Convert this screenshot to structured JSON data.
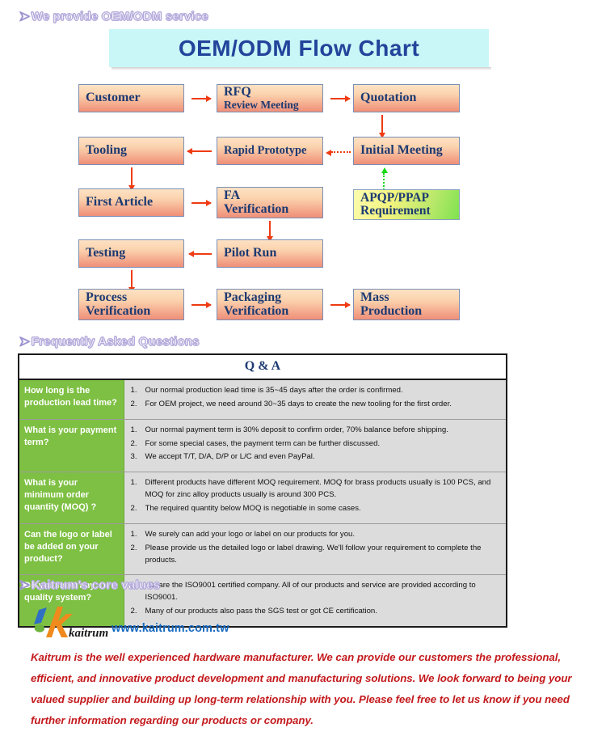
{
  "sections": {
    "oem": "We provide OEM/ODM service",
    "faq": "Frequently Asked Questions",
    "core": "Kaitrum's core values"
  },
  "flowchart": {
    "banner_title": "OEM/ODM Flow Chart",
    "banner_bg": "#c9f6f6",
    "box_border": "#7b8fb5",
    "box_text_color": "#1d3a72",
    "arrow_color": "#ef3b12",
    "green_arrow_color": "#16d916",
    "boxes": [
      {
        "id": "customer",
        "line1": "Customer",
        "line2": ""
      },
      {
        "id": "rfq",
        "line1": "RFQ",
        "line2": "Review Meeting"
      },
      {
        "id": "quotation",
        "line1": "Quotation",
        "line2": ""
      },
      {
        "id": "tooling",
        "line1": "Tooling",
        "line2": ""
      },
      {
        "id": "rapid-prototype",
        "line1": "Rapid Prototype",
        "line2": ""
      },
      {
        "id": "initial-meeting",
        "line1": "Initial Meeting",
        "line2": ""
      },
      {
        "id": "first-article",
        "line1": "First Article",
        "line2": ""
      },
      {
        "id": "fa-verification",
        "line1": "FA",
        "line2": "Verification"
      },
      {
        "id": "apqp-ppap",
        "line1": "APQP/PPAP",
        "line2": "Requirement"
      },
      {
        "id": "testing",
        "line1": "Testing",
        "line2": ""
      },
      {
        "id": "pilot-run",
        "line1": "Pilot Run",
        "line2": ""
      },
      {
        "id": "process-verification",
        "line1": "Process",
        "line2": "Verification"
      },
      {
        "id": "packaging-verification",
        "line1": "Packaging",
        "line2": "Verification"
      },
      {
        "id": "mass-production",
        "line1": "Mass",
        "line2": "Production"
      }
    ]
  },
  "qa": {
    "title": "Q & A",
    "question_bg": "#7ec043",
    "answer_bg": "#dcdcdc",
    "rows": [
      {
        "question": "How long is the production lead time?",
        "answers": [
          "Our normal production lead time is 35~45 days after the order is confirmed.",
          "For OEM project, we need around 30~35 days to create the new tooling for the first order."
        ]
      },
      {
        "question": "What is your payment term?",
        "answers": [
          "Our normal payment term is 30% deposit to confirm order, 70% balance before shipping.",
          "For some special cases, the payment term can be further discussed.",
          "We accept T/T, D/A, D/P or L/C and even PayPal."
        ]
      },
      {
        "question": "What is your minimum order quantity (MOQ) ?",
        "answers": [
          "Different products have different MOQ requirement. MOQ for brass products usually is 100 PCS, and MOQ for zinc alloy products usually is around 300 PCS.",
          "The required quantity below MOQ is negotiable in some cases."
        ]
      },
      {
        "question": "Can the logo or label be added on your product?",
        "answers": [
          "We surely can add your logo or label on our products for you.",
          "Please provide us the detailed logo or label drawing. We'll follow your requirement to complete the products."
        ]
      },
      {
        "question": "Do you have any quality system?",
        "answers": [
          "We are the ISO9001 certified company. All of our products and service are provided according to ISO9001.",
          "Many of our products also pass the SGS test or got CE certification."
        ]
      }
    ]
  },
  "footer": {
    "logo_wordmark": "kaitrum",
    "logo_colors": {
      "blue": "#2f6fc4",
      "green": "#6db33f",
      "orange": "#f08a1c"
    },
    "website": "www.kaitrum.com.tw",
    "website_color": "#1669c1",
    "blurb": "Kaitrum is the well experienced hardware manufacturer. We can provide our customers the professional, efficient, and innovative product development and manufacturing solutions. We look forward to being your valued supplier and building up long-term relationship with you. Please feel free to let us know if you need further information regarding our products or company.",
    "blurb_color": "#c3191c"
  }
}
